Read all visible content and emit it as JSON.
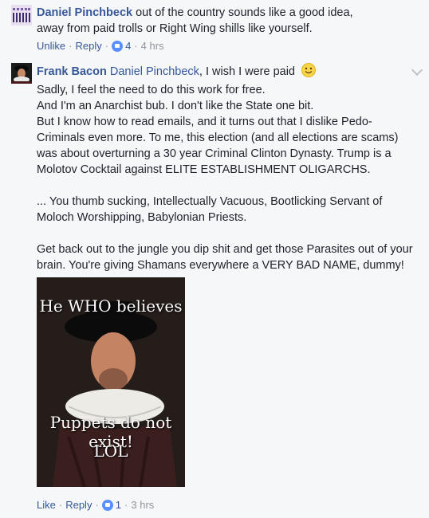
{
  "comments": [
    {
      "author": "Daniel Pinchbeck",
      "text": "out of the country sounds like a good idea, away from paid trolls or Right Wing shills like yourself.",
      "actions": {
        "like": "Unlike",
        "reply": "Reply",
        "reaction_count": "4",
        "time": "4 hrs"
      }
    },
    {
      "author": "Frank Bacon",
      "mention": "Daniel Pinchbeck",
      "first_line": ", I wish I were paid",
      "paragraphs": [
        "Sadly, I feel the need to do this work for free.",
        "And I'm an Anarchist bub. I don't like the State one bit.",
        "But I know how to read emails, and it turns out that I dislike Pedo-Criminals even more. To me, this election (and all elections are scams) was about overturning a 30 year Criminal Clinton Dynasty. Trump is a Molotov Cocktail against ELITE ESTABLISHMENT OLIGARCHS.",
        "... You thumb sucking, Intellectually Vacuous, Bootlicking Servant of Moloch Worshipping, Babylonian Priests.",
        "Get back out to the jungle you dip shit and get those Parasites out of your brain. You're giving Shamans everywhere a VERY BAD NAME, dummy!"
      ],
      "image": {
        "top_text": "He WHO believes",
        "bottom_text_1": "Puppets do not exist!",
        "bottom_text_2": "LOL"
      },
      "actions": {
        "like": "Like",
        "reply": "Reply",
        "reaction_count": "1",
        "time": "3 hrs"
      }
    }
  ]
}
